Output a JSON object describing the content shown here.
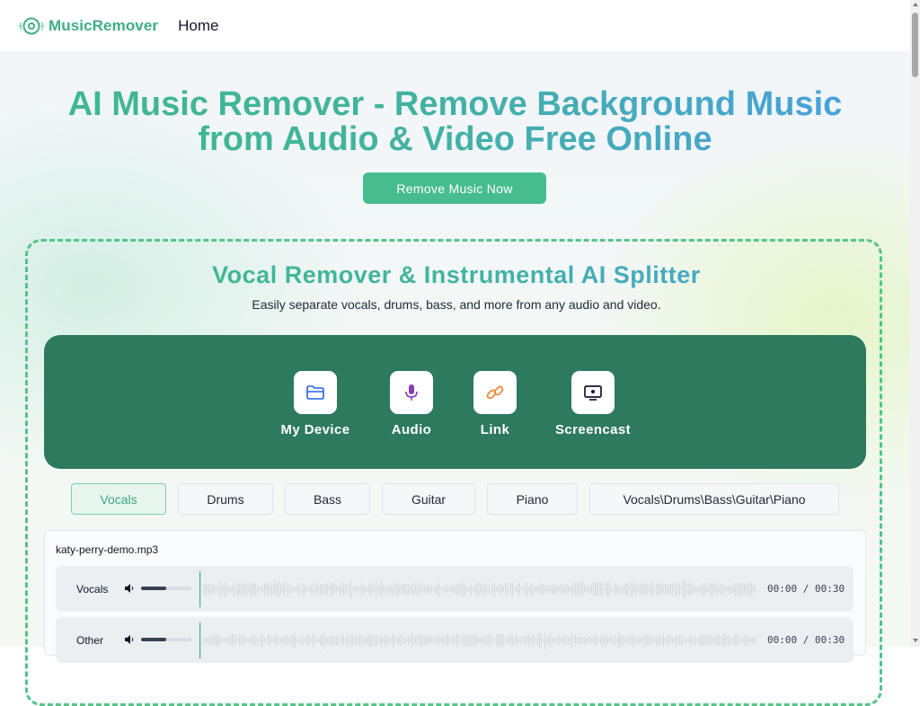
{
  "header": {
    "logo_text": "MusicRemover",
    "nav_home": "Home"
  },
  "hero": {
    "title_line1": "AI Music Remover - Remove Background Music",
    "title_line2": "from Audio & Video Free Online",
    "cta_label": "Remove Music Now"
  },
  "splitter": {
    "title": "Vocal Remover & Instrumental AI Splitter",
    "subtitle": "Easily separate vocals, drums, bass, and more from any audio and video.",
    "sources": [
      {
        "label": "My Device",
        "icon": "folder-icon",
        "color": "#2563eb"
      },
      {
        "label": "Audio",
        "icon": "microphone-icon",
        "color": "#8b3db8"
      },
      {
        "label": "Link",
        "icon": "link-icon",
        "color": "#ef8a3c"
      },
      {
        "label": "Screencast",
        "icon": "screen-icon",
        "color": "#111827"
      }
    ],
    "stem_tabs": [
      "Vocals",
      "Drums",
      "Bass",
      "Guitar",
      "Piano",
      "Vocals\\Drums\\Bass\\Guitar\\Piano"
    ],
    "active_tab": "Vocals"
  },
  "player": {
    "filename": "katy-perry-demo.mp3",
    "tracks": [
      {
        "name": "Vocals",
        "volume": 0.5,
        "time": "00:00 / 00:30"
      },
      {
        "name": "Other",
        "volume": 0.5,
        "time": "00:00 / 00:30"
      }
    ]
  },
  "colors": {
    "brand": "#3fae84",
    "accent_blue": "#4a9fe4",
    "panel": "#2d7a5e"
  }
}
